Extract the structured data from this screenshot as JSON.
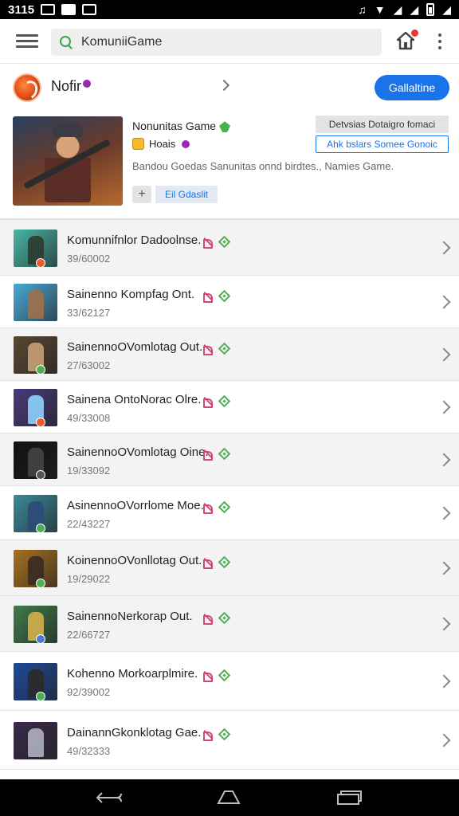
{
  "status_bar": {
    "time": "3115"
  },
  "app_bar": {
    "search_text": "KomuniiGame"
  },
  "profile": {
    "name": "Nofir",
    "action_label": "Gallaltine"
  },
  "featured": {
    "title": "Nonunitas Game",
    "subtitle": "Hoais",
    "description": "Bandou Goedas Sanunitas onnd birdtes., Namies Game.",
    "pill_gray": "Detvsias Dotaigro fomaci",
    "pill_outline": "Ahk bslars Somee Gonoic",
    "chip_plus": "+",
    "chip_blue": "Eil Gdaslit"
  },
  "rows": [
    {
      "title": "Komunnifnlor Dadoolnse.",
      "sub": "39/60002",
      "thumb_bg": "#46b6a6",
      "fig": "#2e3a2e",
      "badge": "#ef5a2a"
    },
    {
      "title": "Sainenno Kompfag Ont.",
      "sub": "33/62127",
      "thumb_bg": "#4aa8d6",
      "fig": "#a0704a",
      "badge": ""
    },
    {
      "title": "SainennoOVomlotag Out.",
      "sub": "27/63002",
      "thumb_bg": "#5a4632",
      "fig": "#c7a078",
      "badge": "#4caf50"
    },
    {
      "title": "Sainena OntoNorac Olre.",
      "sub": "49/33008",
      "thumb_bg": "#4a3a7a",
      "fig": "#8fd0ff",
      "badge": "#ef5a2a"
    },
    {
      "title": "SainennoOVomlotag Oine.",
      "sub": "19/33092",
      "thumb_bg": "#111111",
      "fig": "#444444",
      "badge": "#555555"
    },
    {
      "title": "AsinennoOVorrlome Moe.",
      "sub": "22/43227",
      "thumb_bg": "#3a8a9a",
      "fig": "#2e4a7a",
      "badge": "#4caf50"
    },
    {
      "title": "KoinennoOVonllotag Out.",
      "sub": "19/29022",
      "thumb_bg": "#a8701e",
      "fig": "#3a2a22",
      "badge": "#4caf50"
    },
    {
      "title": "SainennoNerkorap Out.",
      "sub": "22/66727",
      "thumb_bg": "#3e7a4a",
      "fig": "#d4b04a",
      "badge": "#4a7ad6"
    },
    {
      "title": "Kohenno Morkoarpl​mire.",
      "sub": "92/39002",
      "thumb_bg": "#1e4a9a",
      "fig": "#2a2a2a",
      "badge": "#4caf50"
    },
    {
      "title": "DainannGkonklotag Gae.",
      "sub": "49/32333",
      "thumb_bg": "#3a2a4a",
      "fig": "#b0b0c0",
      "badge": ""
    }
  ]
}
